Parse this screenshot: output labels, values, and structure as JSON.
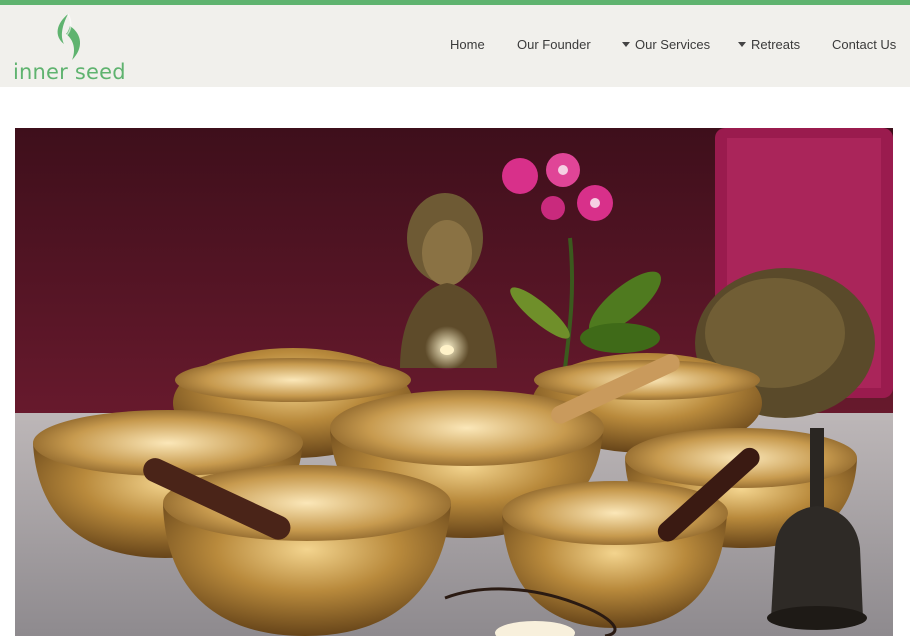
{
  "brand": {
    "name": "inner seed",
    "logo_icon": "leaf-seed-icon",
    "accent_color": "#5fb36f"
  },
  "nav": {
    "items": [
      {
        "label": "Home",
        "has_dropdown": false
      },
      {
        "label": "Our Founder",
        "has_dropdown": false
      },
      {
        "label": "Our Services",
        "has_dropdown": true
      },
      {
        "label": "Retreats",
        "has_dropdown": true
      },
      {
        "label": "Contact Us",
        "has_dropdown": false
      }
    ]
  },
  "hero": {
    "image": "singing-bowls-buddha-orchid-photo"
  }
}
